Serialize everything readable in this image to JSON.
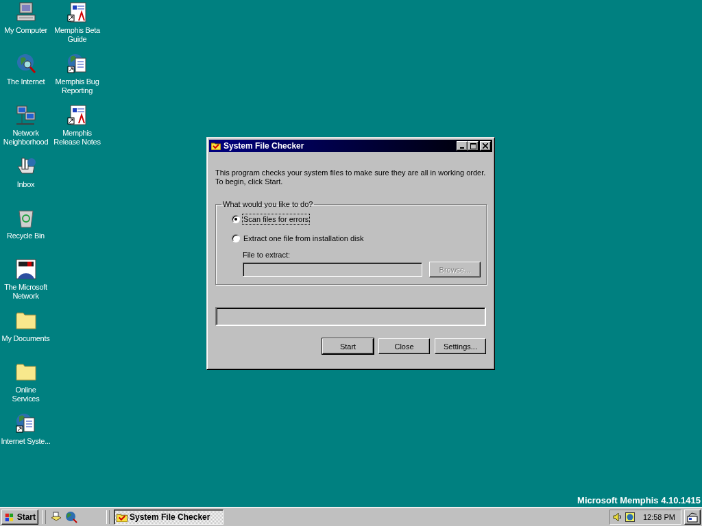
{
  "desktop": {
    "columns": [
      [
        {
          "label": "My Computer",
          "kind": "computer"
        },
        {
          "label": "The Internet",
          "kind": "globe"
        },
        {
          "label": "Network Neighborhood",
          "kind": "network"
        },
        {
          "label": "Inbox",
          "kind": "inbox"
        },
        {
          "label": "Recycle Bin",
          "kind": "recycle"
        },
        {
          "label": "The Microsoft Network",
          "kind": "msn"
        },
        {
          "label": "My Documents",
          "kind": "folder"
        },
        {
          "label": "Online Services",
          "kind": "folder"
        },
        {
          "label": "Internet Syste...",
          "kind": "globedoc"
        }
      ],
      [
        {
          "label": "Memphis Beta Guide",
          "kind": "doc"
        },
        {
          "label": "Memphis Bug Reporting",
          "kind": "globedoc"
        },
        {
          "label": "Memphis Release Notes",
          "kind": "doc"
        }
      ]
    ],
    "build_text": "Microsoft Memphis 4.10.1415"
  },
  "window": {
    "title": "System File Checker",
    "description": "This program checks your system files to make sure they are all in working order. To begin, click Start.",
    "group": {
      "label": "What would you like to do?",
      "options": [
        {
          "label": "Scan files for errors",
          "selected": true
        },
        {
          "label": "Extract one file from installation disk",
          "selected": false
        }
      ],
      "field": {
        "label": "File to extract:",
        "disabled": true
      },
      "browse": {
        "label": "Browse...",
        "disabled": true
      }
    },
    "progress": {
      "level": 0
    },
    "buttons": [
      {
        "label": "Start",
        "default": true
      },
      {
        "label": "Close",
        "default": false
      },
      {
        "label": "Settings...",
        "default": false
      }
    ]
  },
  "taskbar": {
    "start": "Start",
    "tasks": [
      {
        "label": "System File Checker",
        "selected": true
      }
    ],
    "clock": "12:58 PM"
  }
}
